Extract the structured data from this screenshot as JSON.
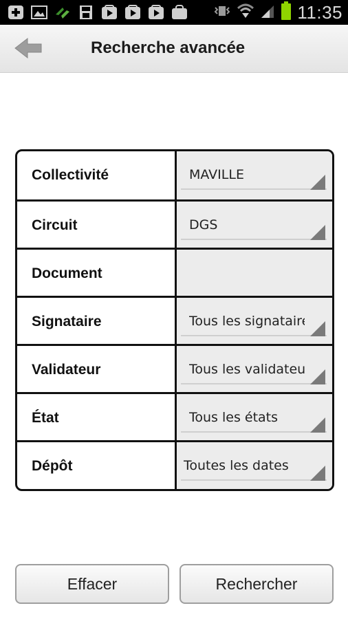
{
  "status_bar": {
    "time": "11:35",
    "icons": [
      "plus-icon",
      "image-icon",
      "transfer-icon",
      "save-icon",
      "play-icon",
      "play-icon",
      "play-icon",
      "shopping-bag-icon",
      "vibrate-icon",
      "wifi-icon",
      "signal-icon",
      "battery-icon"
    ],
    "battery_color": "#8fd400"
  },
  "action_bar": {
    "title": "Recherche avancée",
    "back_icon": "back-arrow-icon"
  },
  "form": {
    "rows": [
      {
        "label": "Collectivité",
        "value": "MAVILLE"
      },
      {
        "label": "Circuit",
        "value": "DGS"
      },
      {
        "label": "Document",
        "value": ""
      },
      {
        "label": "Signataire",
        "value": "Tous les signataires"
      },
      {
        "label": "Validateur",
        "value": "Tous les validateurs"
      },
      {
        "label": "État",
        "value": "Tous les états"
      },
      {
        "label": "Dépôt",
        "value": "Toutes les dates"
      }
    ]
  },
  "buttons": {
    "clear": "Effacer",
    "search": "Rechercher"
  }
}
